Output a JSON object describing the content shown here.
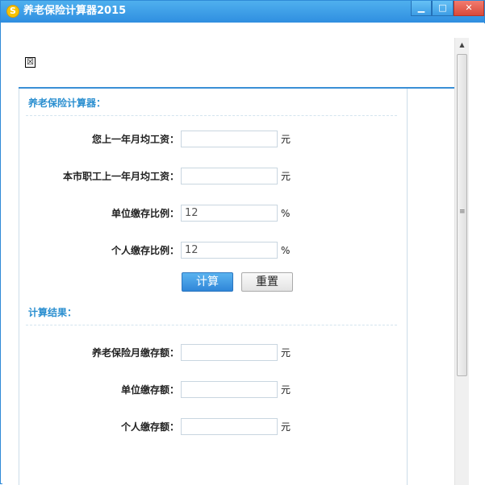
{
  "window": {
    "title": "养老保险计算器2015",
    "app_icon_glyph": "S",
    "min_glyph": "▁",
    "max_glyph": "□",
    "close_glyph": "✕"
  },
  "broken_image_glyph": "☒",
  "calculator": {
    "section_title": "养老保险计算器：",
    "fields": [
      {
        "label": "您上一年月均工资：",
        "value": "",
        "unit": "元"
      },
      {
        "label": "本市职工上一年月均工资：",
        "value": "",
        "unit": "元"
      },
      {
        "label": "单位缴存比例：",
        "value": "12",
        "unit": "%"
      },
      {
        "label": "个人缴存比例：",
        "value": "12",
        "unit": "%"
      }
    ],
    "calc_button": "计算",
    "reset_button": "重置"
  },
  "results": {
    "section_title": "计算结果：",
    "fields": [
      {
        "label": "养老保险月缴存额：",
        "value": "",
        "unit": "元"
      },
      {
        "label": "单位缴存额：",
        "value": "",
        "unit": "元"
      },
      {
        "label": "个人缴存额：",
        "value": "",
        "unit": "元"
      }
    ]
  },
  "scrollbar": {
    "up_arrow": "▲",
    "grip": "≡"
  },
  "colors": {
    "titlebar": "#3a9ce6",
    "section_title": "#2b8fd0",
    "accent_line": "#3a8fd6",
    "calc_button": "#3b91dc"
  }
}
